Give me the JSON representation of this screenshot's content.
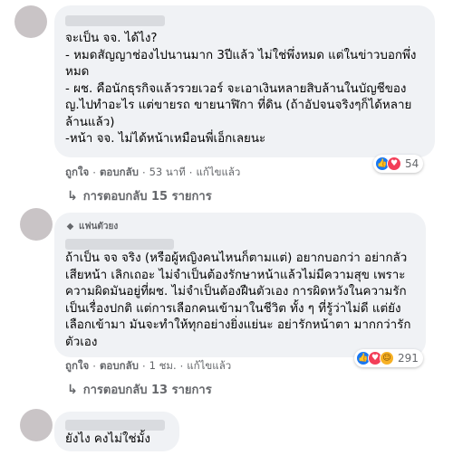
{
  "comments": [
    {
      "text": "จะเป็น จจ. ได้ไง?\n- หมดสัญญาช่องไปนานมาก 3ปีแล้ว ไม่ใช่พึ่งหมด แต่ในข่าวบอกพึ่งหมด\n- ผช. คือนักธุรกิจแล้วรวยเวอร์ จะเอาเงินหลายสิบล้านในบัญชีของญ.ไปทำอะไร แต่ขายรถ ขายนาฬิกา ที่ดิน (ถ้าอัปจนจริงๆก็ได้หลายล้านแล้ว)\n-หน้า จจ. ไม่ได้หน้าเหมือนพี่เอ็กเลยนะ",
      "like_label": "ถูกใจ",
      "reply_label": "ตอบกลับ",
      "time": "53 นาที",
      "edited_label": "แก้ไขแล้ว",
      "reaction_count": "54",
      "replies_label": "การตอบกลับ 15 รายการ"
    },
    {
      "badge": "แฟนตัวยง",
      "text": "ถ้าเป็น จจ จริง (หรือผู้หญิงคนไหนก็ตามแต่) อยากบอกว่า อย่ากลัวเสียหน้า เลิกเถอะ ไม่จำเป็นต้องรักษาหน้าแล้วไม่มีความสุข เพราะความผิดมันอยู่ที่ผช. ไม่จำเป็นต้องฝืนตัวเอง การผิดหวังในความรัก เป็นเรื่องปกติ แต่การเลือกคนเข้ามาในชีวิต ทั้ง ๆ ที่รู้ว่าไม่ดี แต่ยังเลือกเข้ามา มันจะทำให้ทุกอย่างยิ่งแย่นะ อย่ารักหน้าตา มากกว่ารักตัวเอง",
      "like_label": "ถูกใจ",
      "reply_label": "ตอบกลับ",
      "time": "1 ชม.",
      "edited_label": "แก้ไขแล้ว",
      "reaction_count": "291",
      "replies_label": "การตอบกลับ 13 รายการ"
    },
    {
      "text": "ยังไง คงไม่ใช่มั้ง"
    }
  ],
  "separator": "·",
  "icons": {
    "like": "thumbs-up-icon",
    "love": "heart-icon",
    "care": "care-face-icon",
    "badge": "diamond-icon",
    "replies": "reply-arrow-icon"
  },
  "colors": {
    "bubble": "#f0f2f5",
    "meta_text": "#65676b",
    "like": "#1877f2",
    "love": "#f33e58",
    "care": "#f7b125"
  }
}
